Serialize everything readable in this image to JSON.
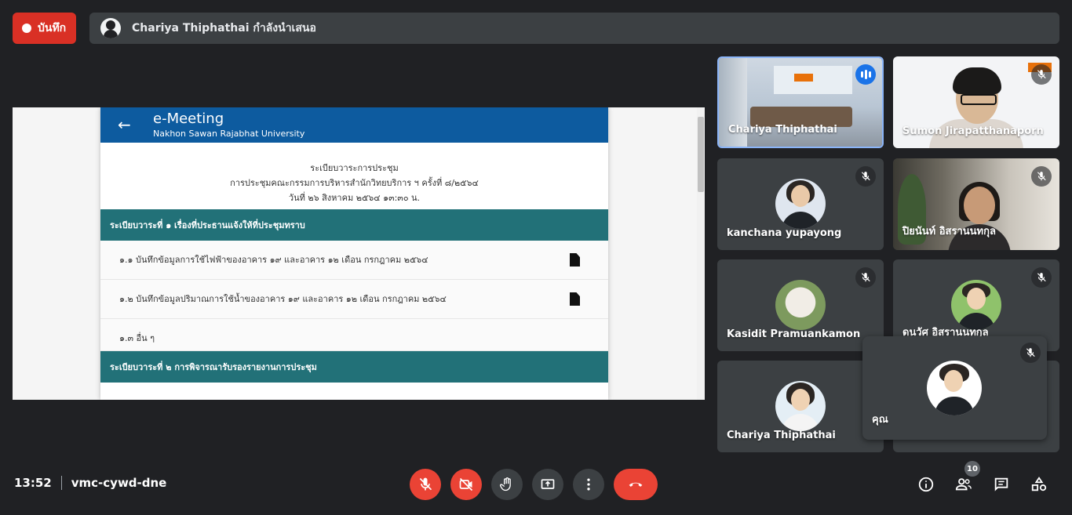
{
  "top": {
    "record_label": "บันทึก",
    "presenter_text": "Chariya Thiphathai กำลังนำเสนอ"
  },
  "screen": {
    "app_title": "e-Meeting",
    "app_subtitle": "Nakhon Sawan Rajabhat University",
    "intro_lines": [
      "ระเบียบวาระการประชุม",
      "การประชุมคณะกรรมการบริหารสำนักวิทยบริการ ฯ ครั้งที่ ๘/๒๕๖๔",
      "วันที่ ๒๖ สิงหาคม ๒๕๖๔ ๑๓:๓๐ น."
    ],
    "section1": "ระเบียบวาระที่ ๑  เรื่องที่ประธานแจ้งให้ที่ประชุมทราบ",
    "items": [
      "๑.๑  บันทึกข้อมูลการใช้ไฟฟ้าของอาคาร ๑๙ และอาคาร ๑๒ เดือน กรกฎาคม ๒๕๖๔",
      "๑.๒  บันทึกข้อมูลปริมาณการใช้น้ำของอาคาร ๑๙ และอาคาร ๑๒ เดือน กรกฎาคม ๒๕๖๔",
      "๑.๓  อื่น ๆ"
    ],
    "section2": "ระเบียบวาระที่ ๒  การพิจารณารับรองรายงานการประชุม"
  },
  "participants": [
    {
      "name": "Chariya Thiphathai"
    },
    {
      "name": "Sumon Jirapatthanaporn"
    },
    {
      "name": "kanchana yupayong"
    },
    {
      "name": "ปิยนันท์ อิสรานนทกุล"
    },
    {
      "name": "Kasidit Pramuankamon"
    },
    {
      "name": "ดนวัศ อิสรานนทกุล"
    },
    {
      "name": "Chariya Thiphathai"
    }
  ],
  "self_tile": {
    "name": "คุณ"
  },
  "bottom": {
    "time": "13:52",
    "meeting_code": "vmc-cywd-dne",
    "participant_count": "10"
  },
  "colors": {
    "record": "#d93025",
    "app_header": "#0d5b9f",
    "section_bar": "#227178",
    "control_red": "#ea4335",
    "speaking": "#1a73e8"
  },
  "icons": [
    "mic-off-icon",
    "camera-off-icon",
    "hand-raise-icon",
    "present-icon",
    "more-icon",
    "end-call-icon",
    "info-icon",
    "people-icon",
    "chat-icon",
    "activities-icon",
    "back-arrow-icon",
    "file-icon"
  ]
}
